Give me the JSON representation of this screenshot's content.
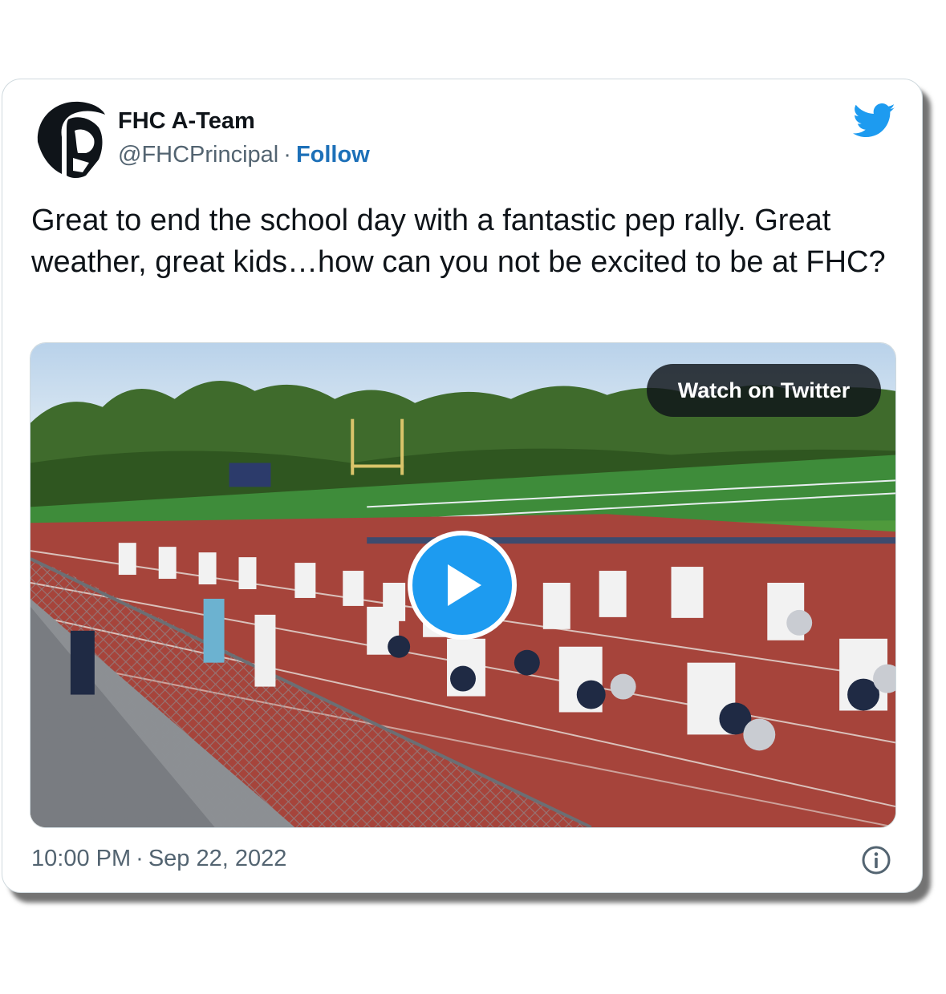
{
  "author": {
    "name": "FHC A-Team",
    "handle": "@FHCPrincipal",
    "separator": "·",
    "follow_label": "Follow",
    "avatar_icon": "spartan-helmet-logo-icon"
  },
  "brand_icon": "twitter-bird-icon",
  "tweet": {
    "text": "Great to end the school day with a fantastic pep rally. Great weather, great kids…how can you not be excited to be at FHC?"
  },
  "media": {
    "watch_label": "Watch on Twitter",
    "play_icon": "play-icon"
  },
  "meta": {
    "time": "10:00 PM",
    "separator": "·",
    "date": "Sep 22, 2022",
    "info_icon": "info-icon"
  },
  "colors": {
    "twitter_blue": "#1d9bf0",
    "follow_blue": "#1d70b8",
    "secondary_text": "#536471",
    "primary_text": "#0f1419"
  }
}
